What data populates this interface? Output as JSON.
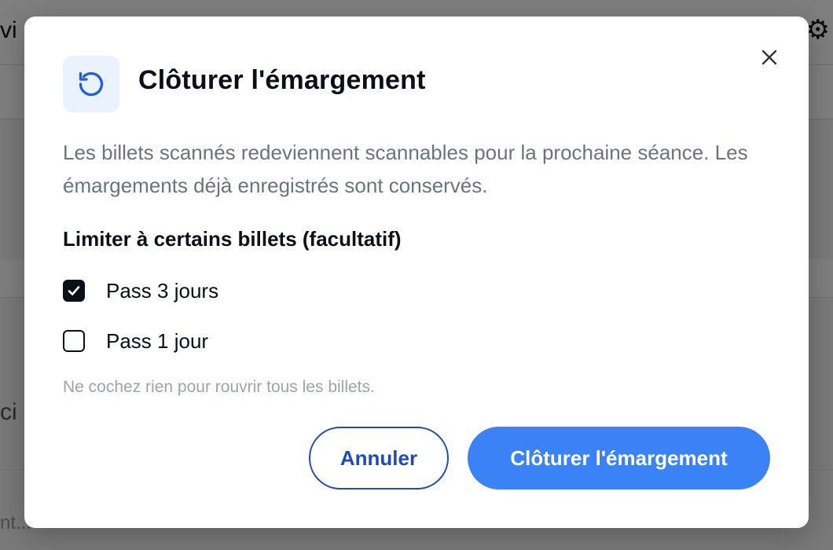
{
  "background": {
    "topbar_partial_text": "vi",
    "side_partial_text": "ci",
    "bottom_partial_text": "nt..."
  },
  "modal": {
    "icon": "rotate-ccw-icon",
    "title": "Clôturer l'émargement",
    "close_icon": "close-icon",
    "description": "Les billets scannés redeviennent scannables pour la prochaine séance. Les émargements déjà enregistrés sont conservés.",
    "section_label": "Limiter à certains billets (facultatif)",
    "options": [
      {
        "label": "Pass 3 jours",
        "checked": true
      },
      {
        "label": "Pass 1 jour",
        "checked": false
      }
    ],
    "hint": "Ne cochez rien pour rouvrir tous les billets.",
    "cancel_label": "Annuler",
    "confirm_label": "Clôturer l'émargement"
  },
  "colors": {
    "primary": "#3b82f6",
    "primary_dark": "#1e4bb8",
    "text_dark": "#0b0f19",
    "text_muted": "#6b7280",
    "icon_bg": "#eaf2fe"
  }
}
